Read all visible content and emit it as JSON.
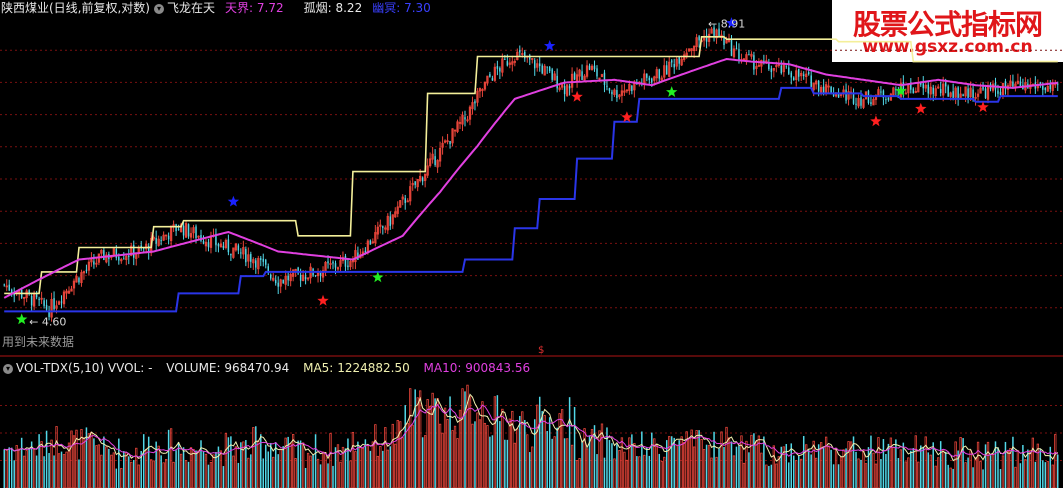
{
  "header": {
    "stock_name": "陕西煤业(日线,前复权,对数)",
    "indicator_name": "飞龙在天",
    "tianjie_label": "天界",
    "tianjie_value": "7.72",
    "guyan_label": "孤烟",
    "guyan_value": "8.22",
    "youming_label": "幽冥",
    "youming_value": "7.30"
  },
  "annotations": {
    "high_marker": "8.91",
    "low_marker": "4.60",
    "future_data_note": "用到未来数据",
    "divider_marker": "$"
  },
  "volume_header": {
    "indicator": "VOL-TDX(5,10)",
    "vvol_label": "VVOL:",
    "vvol_value": "-",
    "volume_label": "VOLUME:",
    "volume_value": "968470.94",
    "ma5_label": "MA5:",
    "ma5_value": "1224882.50",
    "ma10_label": "MA10:",
    "ma10_value": "900843.56"
  },
  "watermark": {
    "cn": "股票公式指标网",
    "url": "www.gsxz.com.cn"
  },
  "colors": {
    "up": "#e8453a",
    "down": "#52d8e8",
    "tianjie": "#f4ef9a",
    "guyan": "#e040e0",
    "youming": "#2a35e8",
    "grid": "#7a1010",
    "divider": "#b01515",
    "star_top": "#1a22ff",
    "star_bottom": "#ff2020",
    "star_buy": "#22ee22",
    "vol_ma5": "#f0f0b0",
    "vol_ma10": "#e040e0",
    "header_text": "#e8e8e8",
    "header_yellow": "#f0f060",
    "header_magenta": "#e040e0",
    "header_blue": "#3a40ff"
  },
  "chart_data": {
    "type": "candlestick",
    "scale": "log",
    "series": [
      {
        "name": "天界",
        "values_ref": "tianjie"
      },
      {
        "name": "孤烟",
        "values_ref": "guyan"
      },
      {
        "name": "幽冥",
        "values_ref": "youming"
      }
    ],
    "price_anchors": [
      [
        0,
        4.9
      ],
      [
        10,
        4.75
      ],
      [
        18,
        4.62
      ],
      [
        28,
        4.95
      ],
      [
        40,
        5.25
      ],
      [
        55,
        5.3
      ],
      [
        70,
        5.62
      ],
      [
        85,
        5.4
      ],
      [
        100,
        5.22
      ],
      [
        110,
        4.95
      ],
      [
        125,
        5.05
      ],
      [
        140,
        5.2
      ],
      [
        155,
        5.7
      ],
      [
        170,
        6.45
      ],
      [
        185,
        7.25
      ],
      [
        195,
        8.0
      ],
      [
        205,
        8.45
      ],
      [
        215,
        8.2
      ],
      [
        225,
        7.8
      ],
      [
        235,
        8.2
      ],
      [
        245,
        7.7
      ],
      [
        255,
        7.9
      ],
      [
        265,
        8.1
      ],
      [
        275,
        8.6
      ],
      [
        285,
        8.91
      ],
      [
        295,
        8.4
      ],
      [
        305,
        8.2
      ],
      [
        315,
        8.1
      ],
      [
        325,
        7.9
      ],
      [
        335,
        7.7
      ],
      [
        345,
        7.6
      ],
      [
        355,
        7.7
      ],
      [
        365,
        7.8
      ],
      [
        375,
        7.75
      ],
      [
        385,
        7.7
      ],
      [
        395,
        7.75
      ],
      [
        405,
        7.8
      ],
      [
        415,
        7.85
      ],
      [
        424,
        7.72
      ]
    ],
    "tianjie_steps": [
      [
        0,
        4.8
      ],
      [
        15,
        5.05
      ],
      [
        30,
        5.35
      ],
      [
        60,
        5.62
      ],
      [
        72,
        5.7
      ],
      [
        100,
        5.7
      ],
      [
        118,
        5.5
      ],
      [
        140,
        6.4
      ],
      [
        170,
        7.7
      ],
      [
        190,
        8.4
      ],
      [
        210,
        8.4
      ],
      [
        270,
        8.4
      ],
      [
        280,
        8.8
      ],
      [
        290,
        8.75
      ],
      [
        335,
        8.7
      ],
      [
        365,
        8.3
      ],
      [
        424,
        8.3
      ]
    ],
    "guyan_anchors": [
      [
        0,
        4.75
      ],
      [
        30,
        5.2
      ],
      [
        60,
        5.3
      ],
      [
        90,
        5.55
      ],
      [
        110,
        5.3
      ],
      [
        140,
        5.2
      ],
      [
        160,
        5.5
      ],
      [
        175,
        6.1
      ],
      [
        190,
        6.8
      ],
      [
        205,
        7.6
      ],
      [
        225,
        7.9
      ],
      [
        245,
        7.95
      ],
      [
        260,
        7.85
      ],
      [
        275,
        8.1
      ],
      [
        290,
        8.35
      ],
      [
        300,
        8.3
      ],
      [
        315,
        8.25
      ],
      [
        330,
        8.05
      ],
      [
        345,
        7.95
      ],
      [
        360,
        7.85
      ],
      [
        375,
        7.95
      ],
      [
        390,
        7.85
      ],
      [
        405,
        7.8
      ],
      [
        424,
        7.9
      ]
    ],
    "youming_steps": [
      [
        0,
        4.6
      ],
      [
        65,
        4.6
      ],
      [
        70,
        4.8
      ],
      [
        95,
        5.0
      ],
      [
        105,
        5.05
      ],
      [
        125,
        5.05
      ],
      [
        180,
        5.05
      ],
      [
        185,
        5.2
      ],
      [
        205,
        5.6
      ],
      [
        215,
        6.0
      ],
      [
        230,
        6.6
      ],
      [
        245,
        7.2
      ],
      [
        255,
        7.6
      ],
      [
        300,
        7.6
      ],
      [
        312,
        7.8
      ],
      [
        325,
        7.7
      ],
      [
        345,
        7.65
      ],
      [
        360,
        7.6
      ],
      [
        390,
        7.55
      ],
      [
        400,
        7.65
      ],
      [
        424,
        7.7
      ]
    ],
    "stars_top": [
      [
        92,
        5.85
      ],
      [
        219,
        8.45
      ],
      [
        292,
        8.92
      ]
    ],
    "stars_bottom": [
      [
        128,
        4.83
      ],
      [
        230,
        7.82
      ],
      [
        250,
        7.45
      ],
      [
        350,
        7.38
      ],
      [
        368,
        7.6
      ],
      [
        393,
        7.63
      ]
    ],
    "stars_buy": [
      [
        7,
        4.6
      ],
      [
        150,
        5.08
      ],
      [
        268,
        7.87
      ],
      [
        360,
        7.89
      ]
    ],
    "price_range": [
      4.3,
      9.2
    ],
    "volume_range": [
      0,
      1600000
    ],
    "bar_count": 424
  }
}
